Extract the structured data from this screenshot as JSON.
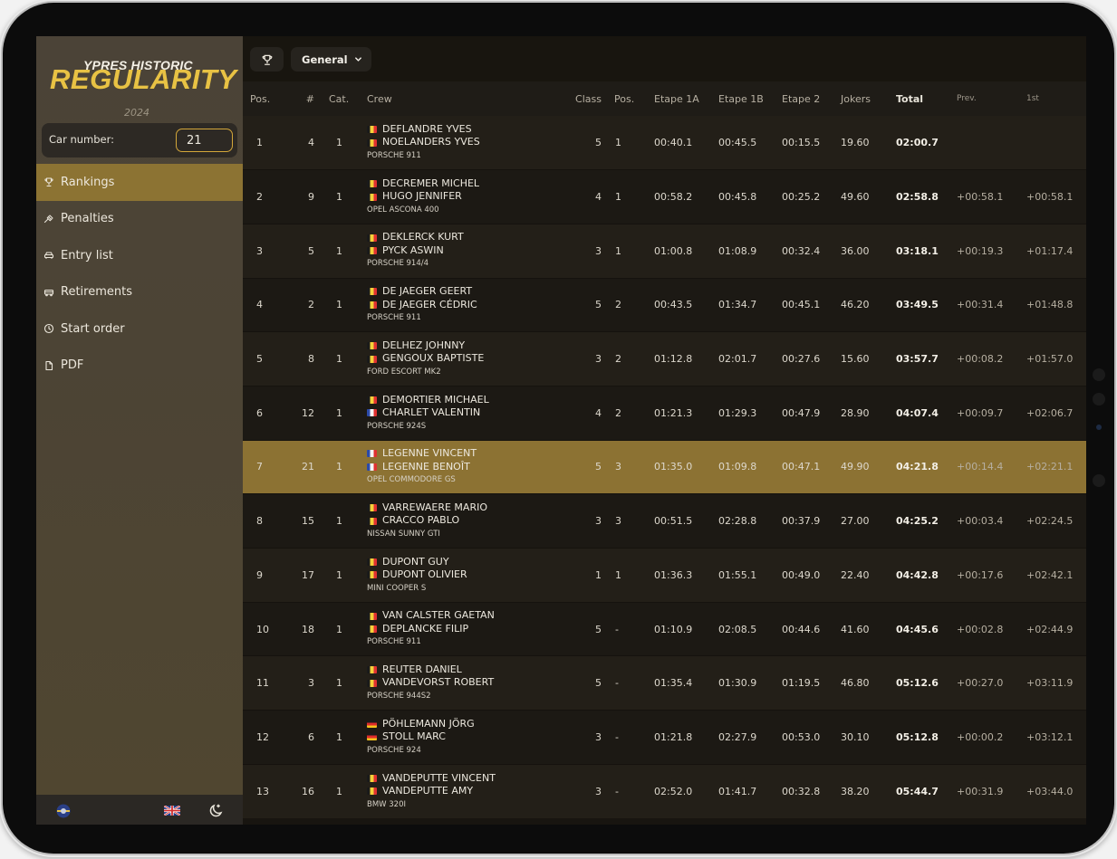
{
  "brand": {
    "title_line1": "YPRES HISTORIC",
    "title_line2": "Regularity",
    "year": "2024"
  },
  "car_number": {
    "label": "Car number:",
    "value": "21"
  },
  "nav": [
    {
      "label": "Rankings",
      "icon": "trophy-icon",
      "active": true
    },
    {
      "label": "Penalties",
      "icon": "gavel-icon"
    },
    {
      "label": "Entry list",
      "icon": "car-icon"
    },
    {
      "label": "Retirements",
      "icon": "tow-icon"
    },
    {
      "label": "Start order",
      "icon": "clock-icon"
    },
    {
      "label": "PDF",
      "icon": "file-icon"
    }
  ],
  "toolbar": {
    "filter_label": "General"
  },
  "columns": [
    "Pos.",
    "#",
    "Cat.",
    "Crew",
    "Class",
    "Pos.",
    "Etape 1A",
    "Etape 1B",
    "Etape 2",
    "Jokers",
    "Total",
    "Prev.",
    "1st"
  ],
  "rows": [
    {
      "pos": "1",
      "num": "4",
      "cat": "1",
      "driver": "DEFLANDRE YVES",
      "driver_flag": "be",
      "codriver": "NOELANDERS YVES",
      "codriver_flag": "be",
      "car": "PORSCHE 911",
      "class": "5",
      "class_pos": "1",
      "e1a": "00:40.1",
      "e1b": "00:45.5",
      "e2": "00:15.5",
      "jokers": "19.60",
      "total": "02:00.7",
      "prev": "",
      "first": ""
    },
    {
      "pos": "2",
      "num": "9",
      "cat": "1",
      "driver": "DECREMER MICHEL",
      "driver_flag": "be",
      "codriver": "HUGO JENNIFER",
      "codriver_flag": "be",
      "car": "OPEL ASCONA 400",
      "class": "4",
      "class_pos": "1",
      "e1a": "00:58.2",
      "e1b": "00:45.8",
      "e2": "00:25.2",
      "jokers": "49.60",
      "total": "02:58.8",
      "prev": "+00:58.1",
      "first": "+00:58.1"
    },
    {
      "pos": "3",
      "num": "5",
      "cat": "1",
      "driver": "DEKLERCK KURT",
      "driver_flag": "be",
      "codriver": "PYCK ASWIN",
      "codriver_flag": "be",
      "car": "PORSCHE 914/4",
      "class": "3",
      "class_pos": "1",
      "e1a": "01:00.8",
      "e1b": "01:08.9",
      "e2": "00:32.4",
      "jokers": "36.00",
      "total": "03:18.1",
      "prev": "+00:19.3",
      "first": "+01:17.4"
    },
    {
      "pos": "4",
      "num": "2",
      "cat": "1",
      "driver": "DE JAEGER GEERT",
      "driver_flag": "be",
      "codriver": "DE JAEGER CÉDRIC",
      "codriver_flag": "be",
      "car": "PORSCHE 911",
      "class": "5",
      "class_pos": "2",
      "e1a": "00:43.5",
      "e1b": "01:34.7",
      "e2": "00:45.1",
      "jokers": "46.20",
      "total": "03:49.5",
      "prev": "+00:31.4",
      "first": "+01:48.8"
    },
    {
      "pos": "5",
      "num": "8",
      "cat": "1",
      "driver": "DELHEZ JOHNNY",
      "driver_flag": "be",
      "codriver": "GENGOUX BAPTISTE",
      "codriver_flag": "be",
      "car": "FORD ESCORT MK2",
      "class": "3",
      "class_pos": "2",
      "e1a": "01:12.8",
      "e1b": "02:01.7",
      "e2": "00:27.6",
      "jokers": "15.60",
      "total": "03:57.7",
      "prev": "+00:08.2",
      "first": "+01:57.0"
    },
    {
      "pos": "6",
      "num": "12",
      "cat": "1",
      "driver": "DEMORTIER MICHAEL",
      "driver_flag": "be",
      "codriver": "CHARLET VALENTIN",
      "codriver_flag": "fr",
      "car": "PORSCHE 924S",
      "class": "4",
      "class_pos": "2",
      "e1a": "01:21.3",
      "e1b": "01:29.3",
      "e2": "00:47.9",
      "jokers": "28.90",
      "total": "04:07.4",
      "prev": "+00:09.7",
      "first": "+02:06.7"
    },
    {
      "pos": "7",
      "num": "21",
      "cat": "1",
      "driver": "LEGENNE VINCENT",
      "driver_flag": "fr",
      "codriver": "LEGENNE BENOÎT",
      "codriver_flag": "fr",
      "car": "OPEL COMMODORE GS",
      "class": "5",
      "class_pos": "3",
      "e1a": "01:35.0",
      "e1b": "01:09.8",
      "e2": "00:47.1",
      "jokers": "49.90",
      "total": "04:21.8",
      "prev": "+00:14.4",
      "first": "+02:21.1",
      "highlight": true
    },
    {
      "pos": "8",
      "num": "15",
      "cat": "1",
      "driver": "VARREWAERE MARIO",
      "driver_flag": "be",
      "codriver": "CRACCO PABLO",
      "codriver_flag": "be",
      "car": "NISSAN SUNNY GTI",
      "class": "3",
      "class_pos": "3",
      "e1a": "00:51.5",
      "e1b": "02:28.8",
      "e2": "00:37.9",
      "jokers": "27.00",
      "total": "04:25.2",
      "prev": "+00:03.4",
      "first": "+02:24.5"
    },
    {
      "pos": "9",
      "num": "17",
      "cat": "1",
      "driver": "DUPONT GUY",
      "driver_flag": "be",
      "codriver": "DUPONT OLIVIER",
      "codriver_flag": "be",
      "car": "MINI COOPER S",
      "class": "1",
      "class_pos": "1",
      "e1a": "01:36.3",
      "e1b": "01:55.1",
      "e2": "00:49.0",
      "jokers": "22.40",
      "total": "04:42.8",
      "prev": "+00:17.6",
      "first": "+02:42.1"
    },
    {
      "pos": "10",
      "num": "18",
      "cat": "1",
      "driver": "VAN CALSTER GAETAN",
      "driver_flag": "be",
      "codriver": "DEPLANCKE FILIP",
      "codriver_flag": "be",
      "car": "PORSCHE 911",
      "class": "5",
      "class_pos": "-",
      "e1a": "01:10.9",
      "e1b": "02:08.5",
      "e2": "00:44.6",
      "jokers": "41.60",
      "total": "04:45.6",
      "prev": "+00:02.8",
      "first": "+02:44.9"
    },
    {
      "pos": "11",
      "num": "3",
      "cat": "1",
      "driver": "REUTER DANIEL",
      "driver_flag": "be",
      "codriver": "VANDEVORST ROBERT",
      "codriver_flag": "be",
      "car": "PORSCHE 944S2",
      "class": "5",
      "class_pos": "-",
      "e1a": "01:35.4",
      "e1b": "01:30.9",
      "e2": "01:19.5",
      "jokers": "46.80",
      "total": "05:12.6",
      "prev": "+00:27.0",
      "first": "+03:11.9"
    },
    {
      "pos": "12",
      "num": "6",
      "cat": "1",
      "driver": "PÖHLEMANN JÖRG",
      "driver_flag": "de",
      "codriver": "STOLL MARC",
      "codriver_flag": "de",
      "car": "PORSCHE 924",
      "class": "3",
      "class_pos": "-",
      "e1a": "01:21.8",
      "e1b": "02:27.9",
      "e2": "00:53.0",
      "jokers": "30.10",
      "total": "05:12.8",
      "prev": "+00:00.2",
      "first": "+03:12.1"
    },
    {
      "pos": "13",
      "num": "16",
      "cat": "1",
      "driver": "VANDEPUTTE VINCENT",
      "driver_flag": "be",
      "codriver": "VANDEPUTTE AMY",
      "codriver_flag": "be",
      "car": "BMW 320I",
      "class": "3",
      "class_pos": "-",
      "e1a": "02:52.0",
      "e1b": "01:41.7",
      "e2": "00:32.8",
      "jokers": "38.20",
      "total": "05:44.7",
      "prev": "+00:31.9",
      "first": "+03:44.0"
    }
  ],
  "colors": {
    "accent": "#8c7333",
    "brand_yellow": "#e8c244",
    "input_border": "#d4a73a"
  }
}
